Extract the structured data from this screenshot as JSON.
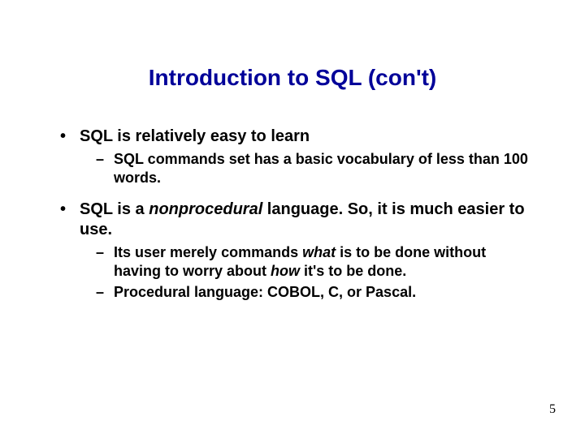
{
  "title": "Introduction to SQL (con't)",
  "bullets": [
    {
      "text": "SQL is relatively easy to learn",
      "sub": [
        {
          "text": "SQL commands set has a basic vocabulary of less than 100 words."
        }
      ]
    },
    {
      "pre": "SQL is a ",
      "em": "nonprocedural",
      "post": " language. So, it is much easier to use.",
      "sub": [
        {
          "pre": "Its user merely commands ",
          "em1": "what",
          "mid": " is to be done without having to worry about ",
          "em2": "how",
          "post": " it's to be done."
        },
        {
          "text": "Procedural language: COBOL, C, or Pascal."
        }
      ]
    }
  ],
  "page_number": "5"
}
